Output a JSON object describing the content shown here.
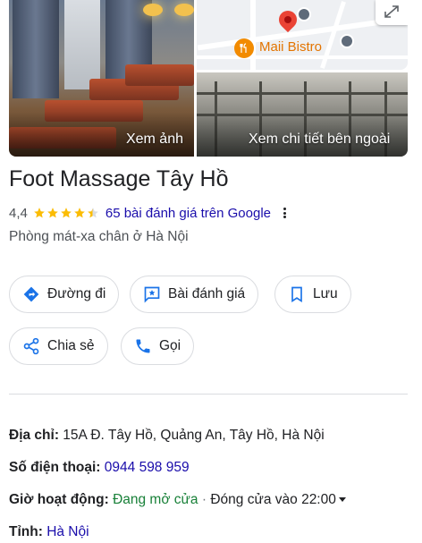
{
  "photos": {
    "main_overlay": "Xem ảnh",
    "street_overlay": "Xem chi tiết bên ngoài",
    "map_poi_label": "Maii Bistro",
    "map_poi_icon": "restaurant-icon",
    "map_transit_icon": "bus-stop-icon",
    "map_pin_icon": "location-pin-icon",
    "map_expand_icon": "expand-icon"
  },
  "place": {
    "title": "Foot Massage Tây Hồ",
    "rating": "4,4",
    "stars_value": 4.4,
    "stars_max": 5,
    "reviews": "65 bài đánh giá trên Google",
    "category": "Phòng mát-xa chân ở Hà Nội"
  },
  "actions": [
    {
      "label": "Đường đi",
      "icon": "directions-icon"
    },
    {
      "label": "Bài đánh giá",
      "icon": "review-icon"
    },
    {
      "label": "Lưu",
      "icon": "bookmark-icon"
    },
    {
      "label": "Chia sẻ",
      "icon": "share-icon"
    },
    {
      "label": "Gọi",
      "icon": "phone-icon"
    }
  ],
  "details": {
    "address_label": "Địa chỉ:",
    "address_value": "15A Đ. Tây Hồ, Quảng An, Tây Hồ, Hà Nội",
    "phone_label": "Số điện thoại:",
    "phone_value": "0944 598 959",
    "hours_label": "Giờ hoạt động:",
    "hours_status": "Đang mở cửa",
    "hours_separator": "·",
    "hours_close": "Đóng cửa vào 22:00",
    "province_label": "Tỉnh:",
    "province_value": "Hà Nội"
  },
  "colors": {
    "link": "#1a0dab",
    "star": "#fbbc04",
    "open": "#188038",
    "pin": "#ea4335",
    "poi": "#f28b00",
    "action_icon": "#1a73e8"
  }
}
